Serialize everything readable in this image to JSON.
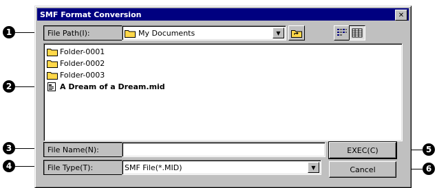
{
  "dialog": {
    "title": "SMF Format Conversion",
    "close_symbol": "✕"
  },
  "markers": [
    "1",
    "2",
    "3",
    "4",
    "5",
    "6"
  ],
  "file_path": {
    "label": "File Path(I):",
    "value": "My Documents"
  },
  "file_list": {
    "items": [
      {
        "name": "Folder-0001",
        "type": "folder"
      },
      {
        "name": "Folder-0002",
        "type": "folder"
      },
      {
        "name": "Folder-0003",
        "type": "folder"
      },
      {
        "name": "A Dream of a Dream.mid",
        "type": "midi-file"
      }
    ]
  },
  "file_name": {
    "label": "File Name(N):",
    "value": ""
  },
  "file_type": {
    "label": "File Type(T):",
    "value": "SMF File(*.MID)"
  },
  "buttons": {
    "exec_label": "EXEC(C)",
    "cancel_label": "Cancel"
  },
  "colors": {
    "titlebar": "#000080",
    "face": "#c0c0c0",
    "folder": "#ffd84a"
  }
}
